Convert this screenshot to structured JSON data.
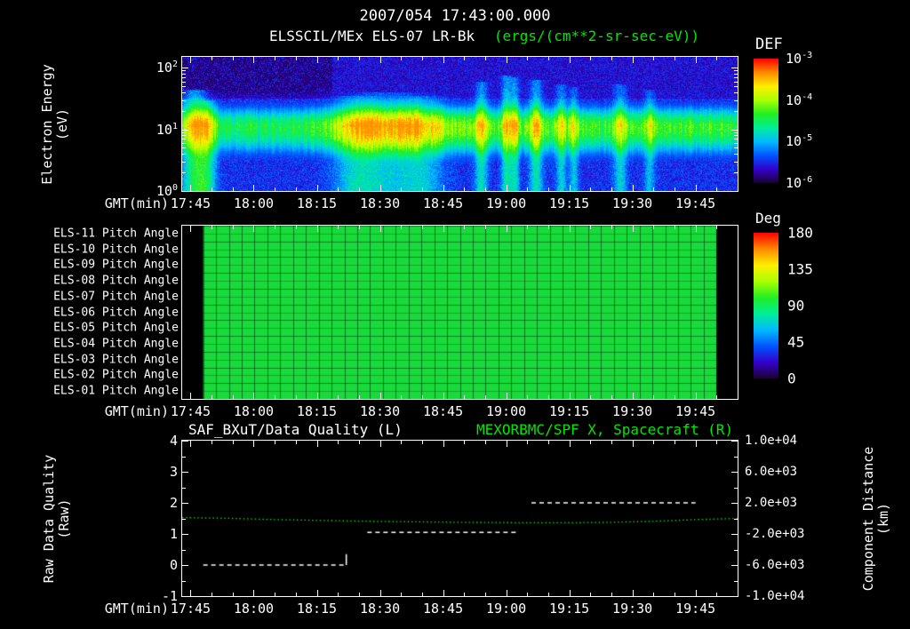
{
  "header": {
    "datetime_title": "2007/054 17:43:00.000",
    "instrument_title": "ELSSCIL/MEx ELS-07 LR-Bk",
    "units_title": "(ergs/(cm**2-sr-sec-eV))"
  },
  "colors": {
    "background": "#000000",
    "foreground": "#ffffff",
    "green_accent": "#00e800",
    "rainbow": [
      "#1a0033",
      "#3300cc",
      "#0055ff",
      "#00bbff",
      "#00ee99",
      "#22ee22",
      "#aaff00",
      "#ffee00",
      "#ff8800",
      "#ff0000"
    ]
  },
  "time_axis": {
    "label": "GMT(min)",
    "start": "17:43",
    "end": "19:55",
    "ticks": [
      "17:45",
      "18:00",
      "18:15",
      "18:30",
      "18:45",
      "19:00",
      "19:15",
      "19:30",
      "19:45"
    ]
  },
  "panel_spectrogram": {
    "ylabel_line1": "Electron Energy",
    "ylabel_line2": "(eV)",
    "yticks": [
      {
        "base": "10",
        "exp": "2",
        "eV": 100
      },
      {
        "base": "10",
        "exp": "1",
        "eV": 10
      },
      {
        "base": "10",
        "exp": "0",
        "eV": 1
      }
    ],
    "colorbar": {
      "title": "DEF",
      "ticks": [
        {
          "base": "10",
          "exp": "-3"
        },
        {
          "base": "10",
          "exp": "-4"
        },
        {
          "base": "10",
          "exp": "-5"
        },
        {
          "base": "10",
          "exp": "-6"
        }
      ]
    }
  },
  "panel_pitch": {
    "colorbar": {
      "title": "Deg",
      "ticks": [
        "180",
        "135",
        "90",
        "45",
        "0"
      ]
    }
  },
  "panel_line": {
    "title_left": "SAF_BXuT/Data Quality (L)",
    "title_right": "MEXORBMC/SPF X, Spacecraft (R)",
    "ylabel_left_line1": "Raw Data Quality",
    "ylabel_left_line2": "(Raw)",
    "yticks_left": [
      "4",
      "3",
      "2",
      "1",
      "0",
      "-1"
    ],
    "ylabel_right_line1": "Component Distance",
    "ylabel_right_line2": "(km)",
    "yticks_right": [
      "1.0e+04",
      "6.0e+03",
      "2.0e+03",
      "-2.0e+03",
      "-6.0e+03",
      "-1.0e+04"
    ]
  },
  "chart_data": [
    {
      "type": "heatmap",
      "title": "ELSSCIL/MEx ELS-07 LR-Bk (ergs/(cm**2-sr-sec-eV))",
      "xlabel": "GMT(min)",
      "ylabel": "Electron Energy (eV)",
      "x_range": [
        "17:43",
        "19:55"
      ],
      "y_range_eV": [
        1,
        150
      ],
      "y_scale": "log",
      "colorbar": {
        "title": "DEF",
        "range_ergs": [
          1e-06,
          0.001
        ],
        "scale": "log"
      },
      "summary": "Continuous band of low-energy electron flux between about 5 and 25 eV for the whole interval, brightest (yellow, ~1e-4) 18:20-18:45, with short bright vertical bursts near 17:46 and between 18:52 and 19:35; faint blue noisy background (~1e-6 to 1e-5) elsewhere and dark patches above 30 eV before 18:15",
      "band": {
        "center_eV": 11,
        "sigma_log_above": 0.26,
        "sigma_log_below": 0.34
      },
      "intensity_envelope": [
        [
          "17:43",
          0.52
        ],
        [
          "18:03",
          0.5
        ],
        [
          "18:17",
          0.56
        ],
        [
          "18:26",
          0.66
        ],
        [
          "18:36",
          0.7
        ],
        [
          "18:46",
          0.62
        ],
        [
          "18:56",
          0.58
        ],
        [
          "19:25",
          0.57
        ],
        [
          "19:55",
          0.55
        ]
      ],
      "enhancements": [
        {
          "time": "17:46",
          "width_min": 3,
          "amp": 0.4,
          "top_eV": 45
        },
        {
          "time": "17:49",
          "width_min": 2,
          "amp": 0.25,
          "top_eV": 30
        },
        {
          "time": "18:24",
          "width_min": 5,
          "amp": 0.18,
          "top_eV": 35
        },
        {
          "time": "18:31",
          "width_min": 8,
          "amp": 0.2,
          "top_eV": 40
        },
        {
          "time": "18:40",
          "width_min": 5,
          "amp": 0.18,
          "top_eV": 35
        },
        {
          "time": "18:54",
          "width_min": 1.5,
          "amp": 0.28,
          "top_eV": 60
        },
        {
          "time": "19:00",
          "width_min": 1.2,
          "amp": 0.32,
          "top_eV": 75
        },
        {
          "time": "19:02",
          "width_min": 1.0,
          "amp": 0.28,
          "top_eV": 70
        },
        {
          "time": "19:07",
          "width_min": 1.5,
          "amp": 0.3,
          "top_eV": 65
        },
        {
          "time": "19:13",
          "width_min": 1.2,
          "amp": 0.24,
          "top_eV": 55
        },
        {
          "time": "19:16",
          "width_min": 1.0,
          "amp": 0.22,
          "top_eV": 50
        },
        {
          "time": "19:27",
          "width_min": 1.5,
          "amp": 0.24,
          "top_eV": 55
        },
        {
          "time": "19:34",
          "width_min": 1.2,
          "amp": 0.2,
          "top_eV": 45
        }
      ]
    },
    {
      "type": "heatmap",
      "rows": [
        "ELS-11 Pitch Angle",
        "ELS-10 Pitch Angle",
        "ELS-09 Pitch Angle",
        "ELS-08 Pitch Angle",
        "ELS-07 Pitch Angle",
        "ELS-06 Pitch Angle",
        "ELS-05 Pitch Angle",
        "ELS-04 Pitch Angle",
        "ELS-03 Pitch Angle",
        "ELS-02 Pitch Angle",
        "ELS-01 Pitch Angle"
      ],
      "value_deg": 95,
      "data_start": "17:48",
      "data_end": "19:50",
      "sweep_columns": 40,
      "colorbar": {
        "title": "Deg",
        "range": [
          0,
          180
        ]
      },
      "summary": "All eleven ELS anode pitch-angle panels show a nearly uniform ~90-100 deg (green) value from 17:48 to 19:50, displayed as a gridded green block over black"
    },
    {
      "type": "line",
      "xlabel": "GMT(min)",
      "ylim_left": [
        -1,
        4
      ],
      "ylim_right": [
        -10000,
        10000
      ],
      "series": [
        {
          "name": "SAF_BXuT/Data Quality (L)",
          "axis": "left",
          "color": "#ffffff",
          "style": "dashed",
          "segments": [
            {
              "from": "17:48",
              "to": "18:22",
              "value": 0
            },
            {
              "from": "18:27",
              "to": "19:03",
              "value": 1.05
            },
            {
              "from": "19:06",
              "to": "19:45",
              "value": 2
            }
          ],
          "end_mark": {
            "time": "18:22",
            "value_from": 0,
            "value_to": 0.35
          }
        },
        {
          "name": "MEXORBMC/SPF X, Spacecraft (R)",
          "axis": "right",
          "color": "#00e800",
          "style": "dotted",
          "points_km": [
            [
              "17:43",
              100
            ],
            [
              "17:55",
              0
            ],
            [
              "18:05",
              -150
            ],
            [
              "18:15",
              -250
            ],
            [
              "18:25",
              -350
            ],
            [
              "18:35",
              -420
            ],
            [
              "18:45",
              -480
            ],
            [
              "18:55",
              -520
            ],
            [
              "19:05",
              -560
            ],
            [
              "19:15",
              -560
            ],
            [
              "19:25",
              -500
            ],
            [
              "19:35",
              -380
            ],
            [
              "19:45",
              -150
            ],
            [
              "19:55",
              0
            ]
          ]
        }
      ]
    }
  ]
}
